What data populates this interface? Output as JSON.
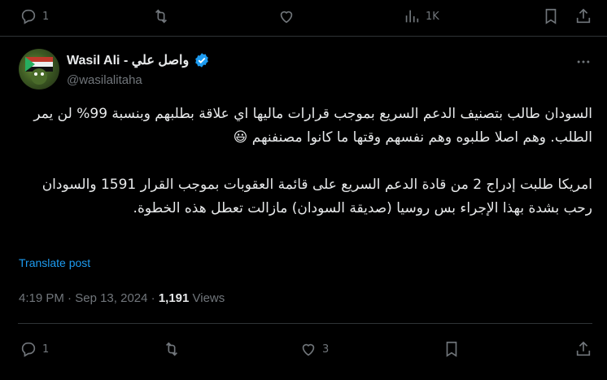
{
  "top_bar": {
    "reply_count": "1",
    "retweet_count": "",
    "like_count": "",
    "views_count": "1K"
  },
  "author": {
    "display_name": "Wasil Ali - واصل علي",
    "handle": "@wasilalitaha",
    "verified": true
  },
  "post": {
    "paragraph1": "السودان طالب بتصنيف الدعم السريع بموجب قرارات ماليها اي علاقة بطلبهم وبنسبة 99% لن يمر الطلب. وهم اصلا طلبوه وهم نفسهم وقتها ما كانوا مصنفنهم 😃",
    "paragraph2": "امريكا طلبت إدراج 2 من قادة الدعم السريع على قائمة العقوبات بموجب القرار 1591 والسودان رحب بشدة بهذا الإجراء بس روسيا (صديقة السودان) مازالت تعطل هذه الخطوة."
  },
  "translate_label": "Translate post",
  "meta": {
    "time": "4:19 PM",
    "sep1": " · ",
    "date": "Sep 13, 2024",
    "sep2": " · ",
    "views_count": "1,191",
    "views_label": " Views"
  },
  "bottom_bar": {
    "reply_count": "1",
    "retweet_count": "",
    "like_count": "3"
  },
  "colors": {
    "background": "#000000",
    "text": "#e7e9ea",
    "muted": "#71767b",
    "accent": "#1d9bf0",
    "divider": "#2f3336"
  },
  "icons": [
    "reply-icon",
    "retweet-icon",
    "like-icon",
    "views-icon",
    "bookmark-icon",
    "share-icon",
    "verified-icon",
    "more-icon"
  ]
}
